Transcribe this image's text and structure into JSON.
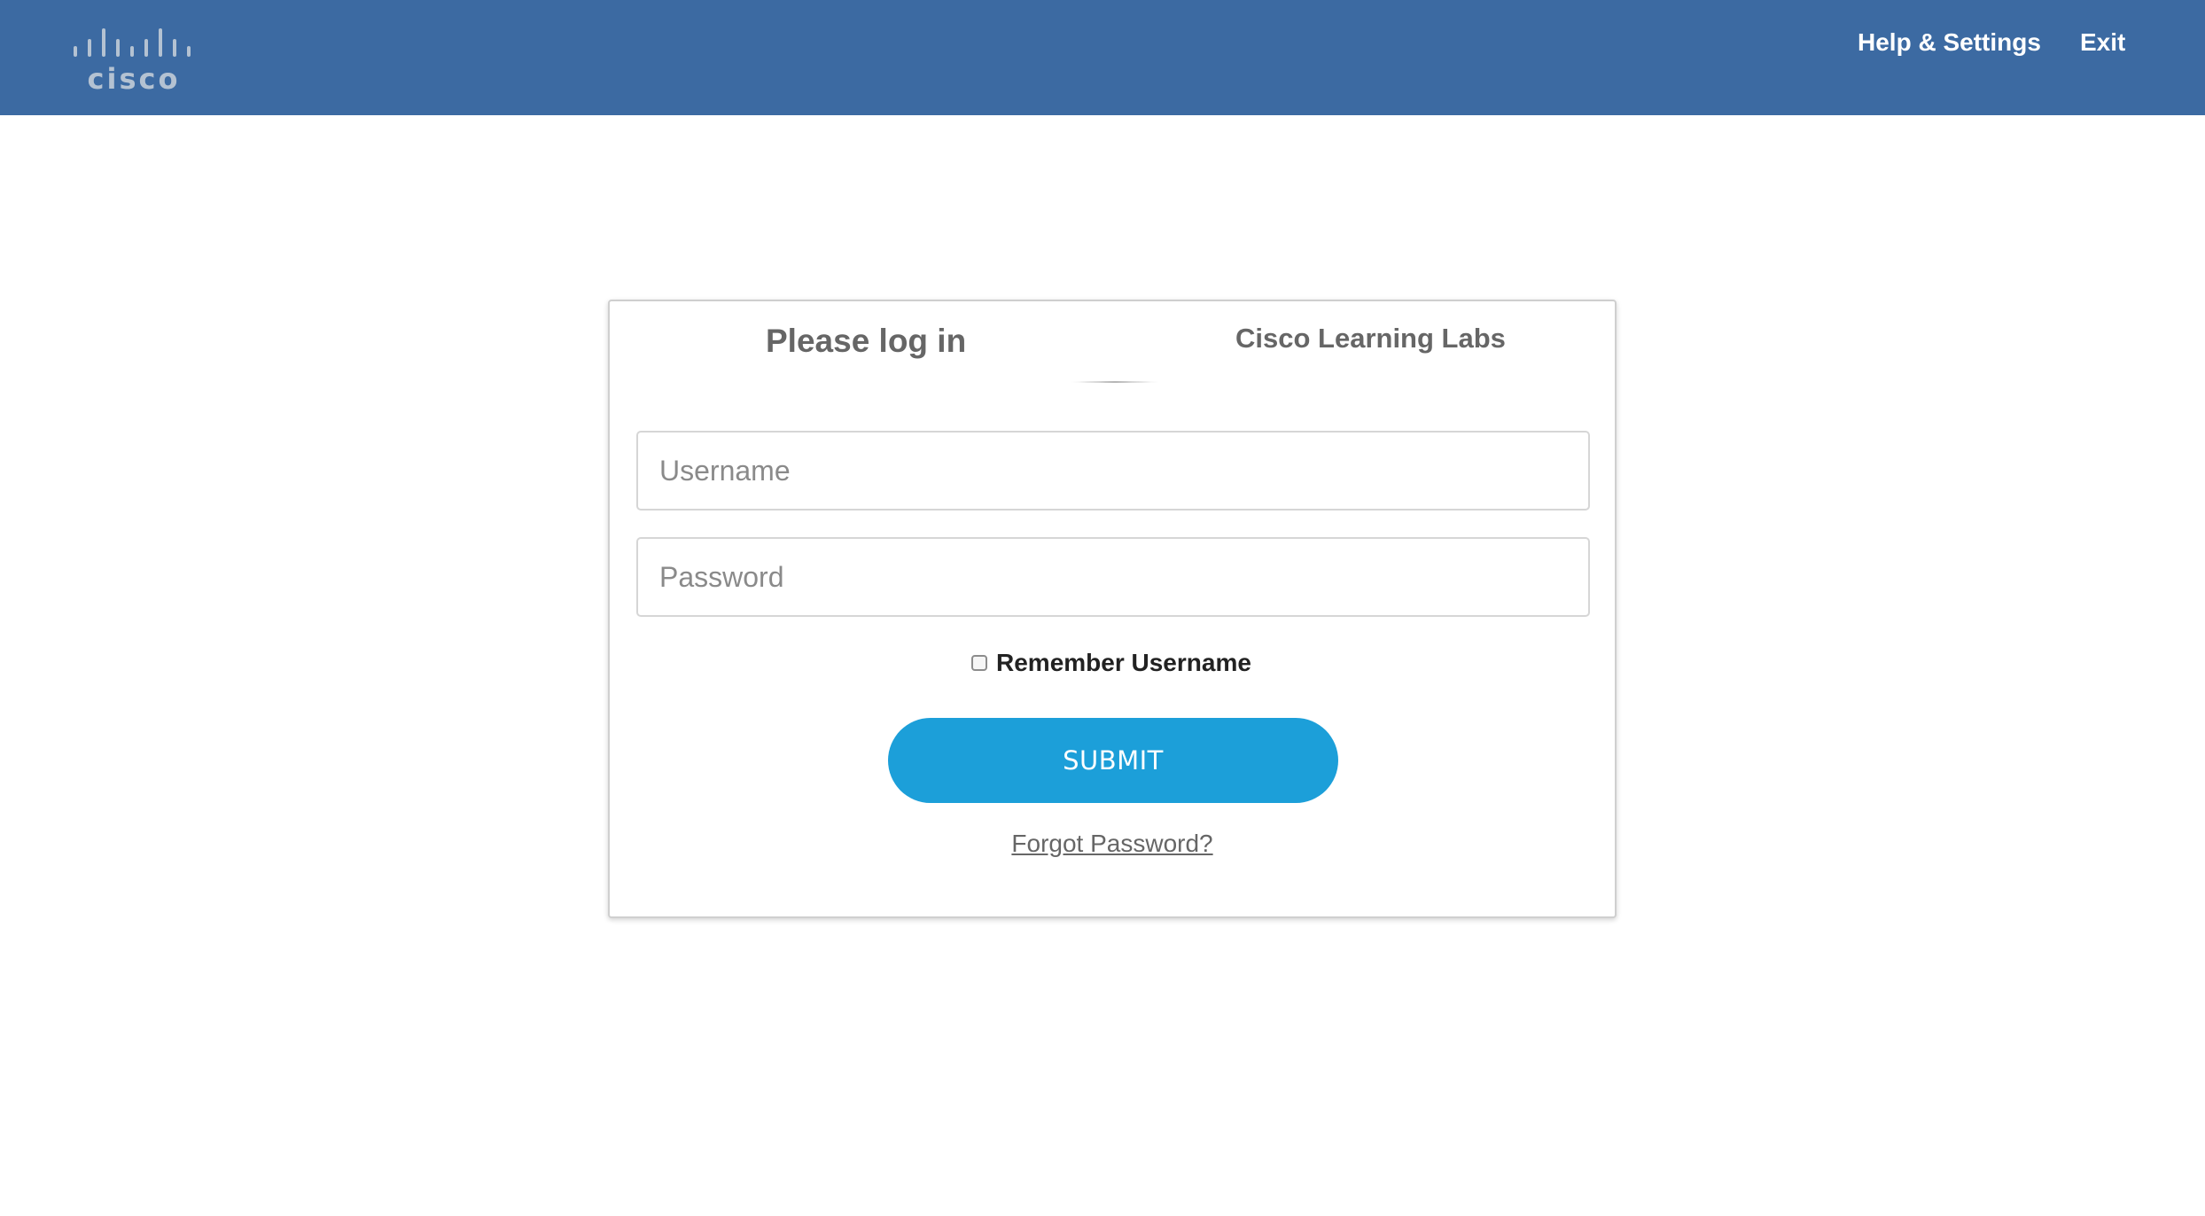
{
  "header": {
    "logo_text": "cisco",
    "nav": {
      "help_settings": "Help & Settings",
      "exit": "Exit"
    }
  },
  "login_card": {
    "title": "Please log in",
    "subtitle": "Cisco Learning Labs",
    "username": {
      "placeholder": "Username",
      "value": ""
    },
    "password": {
      "placeholder": "Password",
      "value": ""
    },
    "remember_label": "Remember Username",
    "remember_checked": false,
    "submit_label": "SUBMIT",
    "forgot_label": "Forgot Password?"
  },
  "colors": {
    "header_bg": "#3c6aa2",
    "submit_bg": "#1c9fd9",
    "logo": "#b4c2d2"
  }
}
